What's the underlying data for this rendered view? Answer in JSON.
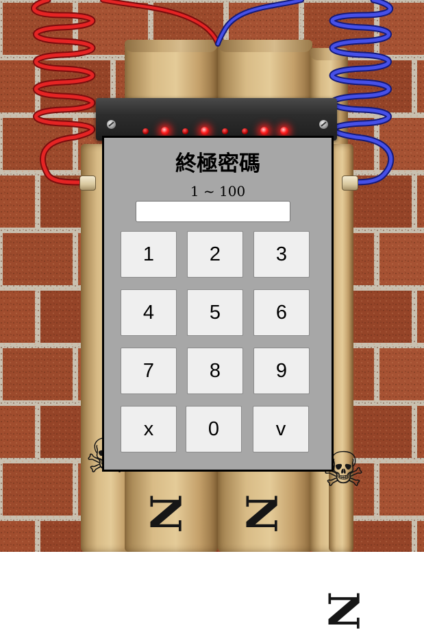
{
  "puzzle": {
    "title": "終極密碼",
    "range_label": "1 ~ 100",
    "input_value": "",
    "keys": [
      "1",
      "2",
      "3",
      "4",
      "5",
      "6",
      "7",
      "8",
      "9",
      "x",
      "0",
      "v"
    ]
  },
  "colors": {
    "panel": "#a7a7a7",
    "key": "#efefef",
    "red_wire": "#e02020",
    "blue_wire": "#4048e0",
    "led_on": "#ff2020"
  },
  "leds": [
    false,
    true,
    false,
    true,
    false,
    false,
    true,
    true
  ]
}
